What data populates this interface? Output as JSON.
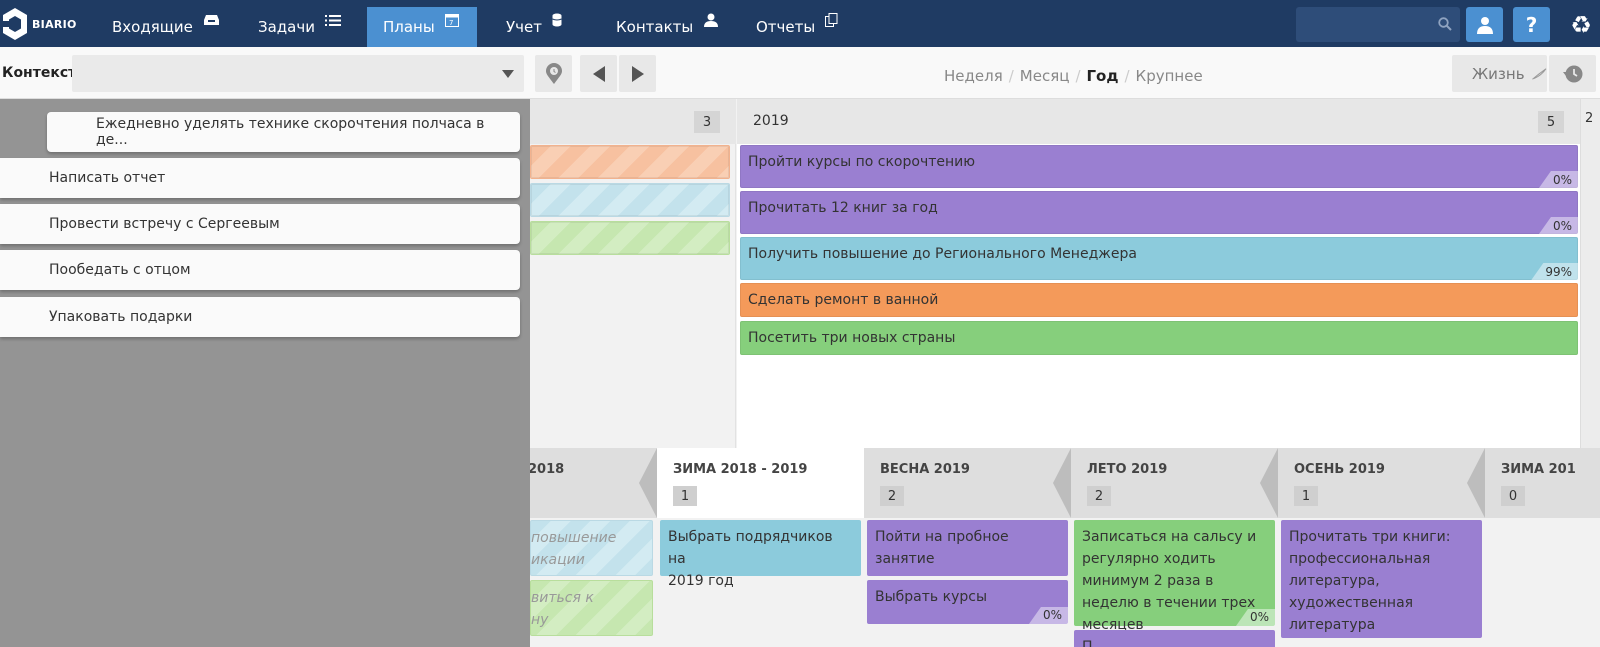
{
  "nav": {
    "logo_text": "BIARIO",
    "items": [
      {
        "label": "Входящие",
        "icon": "inbox-icon",
        "active": false
      },
      {
        "label": "Задачи",
        "icon": "list-icon",
        "active": false
      },
      {
        "label": "Планы",
        "icon": "calendar-icon",
        "active": true
      },
      {
        "label": "Учет",
        "icon": "database-icon",
        "active": false
      },
      {
        "label": "Контакты",
        "icon": "person-icon",
        "active": false
      },
      {
        "label": "Отчеты",
        "icon": "documents-icon",
        "active": false
      }
    ],
    "search_value": "",
    "help_label": "?",
    "accent": "#4b90d1",
    "bg": "#1f3b63"
  },
  "toolbar": {
    "context_label": "Контекст",
    "context_value": "",
    "scales": [
      "Неделя",
      "Месяц",
      "Год",
      "Крупнее"
    ],
    "current_scale": "Год",
    "life_label": "Жизнь"
  },
  "year_view": {
    "prev_col": {
      "title": "",
      "count": "3"
    },
    "main_col": {
      "title": "2019",
      "count": "5"
    },
    "next_col_title": "2"
  },
  "year_goals": [
    {
      "text": "Пройти курсы по скорочтению",
      "pct": "0%",
      "color": "purple"
    },
    {
      "text": "Прочитать 12 книг за год",
      "pct": "0%",
      "color": "purple"
    },
    {
      "text": "Получить повышение до Регионального Менеджера",
      "pct": "99%",
      "color": "blue"
    },
    {
      "text": "Сделать ремонт в ванной",
      "pct": "",
      "color": "orange"
    },
    {
      "text": "Посетить три новых страны",
      "pct": "",
      "color": "green"
    }
  ],
  "seasons": [
    {
      "name": "2018",
      "count": ""
    },
    {
      "name": "ЗИМА 2018 - 2019",
      "count": "1"
    },
    {
      "name": "ВЕСНА 2019",
      "count": "2"
    },
    {
      "name": "ЛЕТО 2019",
      "count": "2"
    },
    {
      "name": "ОСЕНЬ 2019",
      "count": "1"
    },
    {
      "name": "ЗИМА 201",
      "count": "0"
    }
  ],
  "season_goals": {
    "prev": [
      "повышение",
      "икации",
      "виться к",
      "ну"
    ],
    "winter": [
      "Выбрать подрядчиков на",
      "2019 год"
    ],
    "spring": [
      {
        "text": "Пойти на пробное занятие",
        "pct": ""
      },
      {
        "text": "Выбрать курсы",
        "pct": "0%"
      }
    ],
    "summer": [
      {
        "text": "Записаться на сальсу и регулярно ходить минимум 2 раза в неделю в течении трех месяцев",
        "pct": "0%"
      },
      {
        "text": "П",
        "pct": ""
      }
    ],
    "autumn": [
      {
        "text": "Прочитать три книги: профессиональная литература, художественная литература",
        "pct": ""
      }
    ]
  },
  "panel": {
    "top_task": "Ежедневно уделять технике скорочтения полчаса в де...",
    "tasks": [
      "Написать отчет",
      "Провести встречу с Сергеевым",
      "Пообедать с отцом",
      "Упаковать подарки"
    ]
  }
}
